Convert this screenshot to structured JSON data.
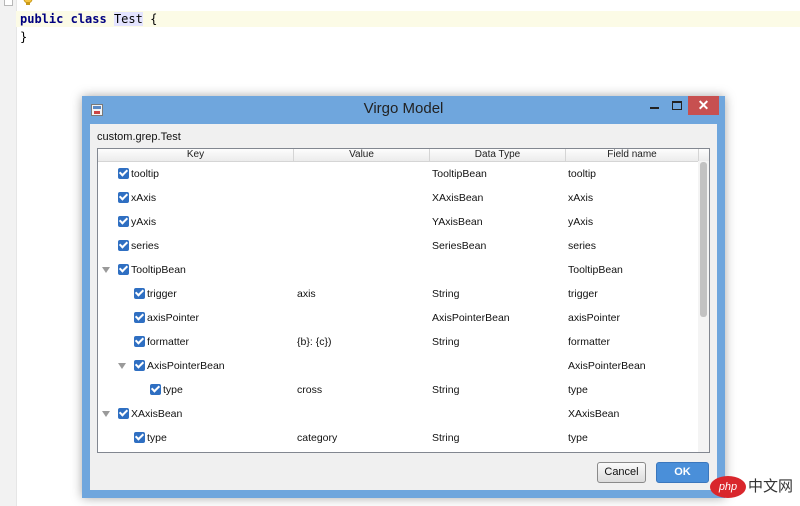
{
  "editor": {
    "line1": {
      "kw1": "public",
      "kw2": "class",
      "class_name": "Test",
      "brace": "{"
    },
    "line2": {
      "brace": "}"
    }
  },
  "dialog": {
    "title": "Virgo Model",
    "close_symbol": "✕",
    "class_path": "custom.grep.Test",
    "columns": [
      "Key",
      "Value",
      "Data Type",
      "Field name"
    ],
    "rows": [
      {
        "key": "tooltip",
        "value": "",
        "type": "TooltipBean",
        "field": "tooltip",
        "checked": true
      },
      {
        "key": "xAxis",
        "value": "",
        "type": "XAxisBean",
        "field": "xAxis",
        "checked": true
      },
      {
        "key": "yAxis",
        "value": "",
        "type": "YAxisBean",
        "field": "yAxis",
        "checked": true
      },
      {
        "key": "series",
        "value": "",
        "type": "SeriesBean",
        "field": "series",
        "checked": true
      },
      {
        "key": "TooltipBean",
        "value": "",
        "type": "",
        "field": "TooltipBean",
        "checked": true,
        "expanded": true
      },
      {
        "key": "trigger",
        "value": "axis",
        "type": "String",
        "field": "trigger",
        "checked": true
      },
      {
        "key": "axisPointer",
        "value": "",
        "type": "AxisPointerBean",
        "field": "axisPointer",
        "checked": true
      },
      {
        "key": "formatter",
        "value": "{b}: {c})",
        "type": "String",
        "field": "formatter",
        "checked": true
      },
      {
        "key": "AxisPointerBean",
        "value": "",
        "type": "",
        "field": "AxisPointerBean",
        "checked": true,
        "expanded": true
      },
      {
        "key": "type",
        "value": "cross",
        "type": "String",
        "field": "type",
        "checked": true
      },
      {
        "key": "XAxisBean",
        "value": "",
        "type": "",
        "field": "XAxisBean",
        "checked": true,
        "expanded": true
      },
      {
        "key": "type",
        "value": "category",
        "type": "String",
        "field": "type",
        "checked": true
      }
    ],
    "cancel_label": "Cancel",
    "ok_label": "OK"
  },
  "watermark": {
    "badge": "php",
    "text": "中文网"
  }
}
